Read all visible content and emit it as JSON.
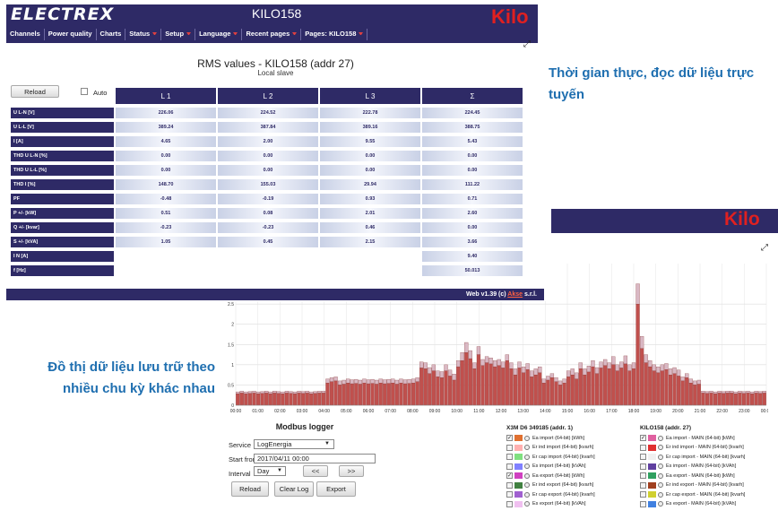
{
  "colors": {
    "brand": "#2e2a66",
    "kilo": "#e02020",
    "note": "#1f6fb0",
    "bar": "#c0504d",
    "bar_top": "#d9b8c4"
  },
  "app": {
    "logo": "ELECTREX",
    "model": "KILO158",
    "brand_badge": "Kilo"
  },
  "menu": [
    {
      "label": "Channels",
      "dropdown": false
    },
    {
      "label": "Power quality",
      "dropdown": false
    },
    {
      "label": "Charts",
      "dropdown": false
    },
    {
      "label": "Status",
      "dropdown": true
    },
    {
      "label": "Setup",
      "dropdown": true
    },
    {
      "label": "Language",
      "dropdown": true
    },
    {
      "label": "Recent pages",
      "dropdown": true
    },
    {
      "label": "Pages: KILO158",
      "dropdown": true
    }
  ],
  "rms": {
    "title": "RMS values - KILO158 (addr 27)",
    "subtitle": "Local slave",
    "reload": "Reload",
    "auto": "Auto",
    "headers": [
      "L 1",
      "L 2",
      "L 3",
      "Σ"
    ],
    "rows": [
      {
        "label": "U L-N [V]",
        "values": [
          "226.06",
          "224.52",
          "222.78",
          "224.45"
        ]
      },
      {
        "label": "U L-L [V]",
        "values": [
          "389.24",
          "387.84",
          "389.16",
          "388.75"
        ]
      },
      {
        "label": "I [A]",
        "values": [
          "4.65",
          "2.00",
          "9.55",
          "5.43"
        ]
      },
      {
        "label": "THD U L-N [%]",
        "values": [
          "0.00",
          "0.00",
          "0.00",
          "0.00"
        ]
      },
      {
        "label": "THD U L-L [%]",
        "values": [
          "0.00",
          "0.00",
          "0.00",
          "0.00"
        ]
      },
      {
        "label": "THD I [%]",
        "values": [
          "148.70",
          "155.03",
          "29.94",
          "111.22"
        ]
      },
      {
        "label": "PF",
        "values": [
          "-0.48",
          "-0.19",
          "0.93",
          "0.71"
        ]
      },
      {
        "label": "P +/- [kW]",
        "values": [
          "0.51",
          "0.08",
          "2.01",
          "2.60"
        ]
      },
      {
        "label": "Q +/- [kvar]",
        "values": [
          "-0.23",
          "-0.23",
          "0.46",
          "0.00"
        ]
      },
      {
        "label": "S +/- [kVA]",
        "values": [
          "1.05",
          "0.45",
          "2.15",
          "3.66"
        ]
      },
      {
        "label": "I N [A]",
        "values": [
          "",
          "",
          "",
          "9.40"
        ]
      },
      {
        "label": "f [Hz]",
        "values": [
          "",
          "",
          "",
          "50.013"
        ]
      }
    ],
    "footer_prefix": "Web v1.39 (c) ",
    "footer_link": "Akse",
    "footer_suffix": " s.r.l."
  },
  "notes": {
    "realtime": "Thời gian thực, đọc dữ liệu trực tuyến",
    "archive": "Đồ thị dữ liệu lưu trữ theo nhiều chu kỳ khác nhau"
  },
  "chart_data": {
    "type": "bar",
    "x_ticks": [
      "00:00",
      "01:00",
      "02:00",
      "03:00",
      "04:00",
      "05:00",
      "06:00",
      "07:00",
      "08:00",
      "09:00",
      "10:00",
      "11:00",
      "12:00",
      "13:00",
      "14:00",
      "15:00",
      "16:00",
      "17:00",
      "18:00",
      "19:00",
      "20:00",
      "21:00",
      "22:00",
      "23:00",
      "00:00"
    ],
    "y_ticks": [
      "0",
      "0.5",
      "1",
      "1.5",
      "2",
      "2.5"
    ],
    "ylim": [
      0,
      3.5
    ],
    "grid": true,
    "series": [
      {
        "values": [
          0.28,
          0.3,
          0.28,
          0.29,
          0.3,
          0.28,
          0.29,
          0.3,
          0.28,
          0.3,
          0.29,
          0.28,
          0.3,
          0.29,
          0.28,
          0.3,
          0.29,
          0.3,
          0.28,
          0.29,
          0.3,
          0.3,
          0.55,
          0.58,
          0.6,
          0.5,
          0.52,
          0.55,
          0.53,
          0.54,
          0.52,
          0.55,
          0.53,
          0.54,
          0.52,
          0.55,
          0.53,
          0.54,
          0.55,
          0.52,
          0.55,
          0.53,
          0.54,
          0.55,
          0.58,
          0.92,
          0.9,
          0.78,
          0.85,
          0.7,
          0.68,
          0.85,
          0.72,
          0.62,
          0.95,
          1.1,
          1.3,
          1.15,
          0.9,
          1.25,
          0.98,
          1.05,
          1.02,
          0.95,
          0.98,
          0.92,
          1.1,
          0.9,
          0.75,
          0.92,
          0.8,
          0.88,
          0.7,
          0.75,
          0.8,
          0.55,
          0.62,
          0.68,
          0.58,
          0.5,
          0.55,
          0.7,
          0.75,
          0.65,
          0.9,
          0.75,
          0.82,
          0.95,
          0.78,
          0.92,
          0.98,
          0.9,
          1.0,
          0.85,
          0.92,
          1.02,
          0.85,
          0.9,
          2.5,
          1.4,
          1.05,
          0.95,
          0.85,
          0.8,
          0.85,
          0.88,
          0.75,
          0.78,
          0.72,
          0.6,
          0.68,
          0.55,
          0.5,
          0.52,
          0.3,
          0.29,
          0.3,
          0.28,
          0.3,
          0.29,
          0.3,
          0.3,
          0.28,
          0.3,
          0.29,
          0.3,
          0.28,
          0.3,
          0.29,
          0.3
        ]
      },
      {
        "values": [
          0.05,
          0.05,
          0.05,
          0.05,
          0.05,
          0.05,
          0.05,
          0.05,
          0.05,
          0.05,
          0.05,
          0.05,
          0.05,
          0.05,
          0.05,
          0.05,
          0.05,
          0.05,
          0.05,
          0.05,
          0.05,
          0.05,
          0.1,
          0.1,
          0.1,
          0.1,
          0.1,
          0.1,
          0.1,
          0.1,
          0.1,
          0.1,
          0.1,
          0.1,
          0.1,
          0.1,
          0.1,
          0.1,
          0.1,
          0.1,
          0.1,
          0.1,
          0.1,
          0.1,
          0.1,
          0.15,
          0.15,
          0.15,
          0.15,
          0.15,
          0.15,
          0.15,
          0.15,
          0.15,
          0.15,
          0.2,
          0.25,
          0.2,
          0.15,
          0.2,
          0.15,
          0.15,
          0.15,
          0.15,
          0.15,
          0.15,
          0.15,
          0.15,
          0.15,
          0.15,
          0.15,
          0.15,
          0.15,
          0.15,
          0.15,
          0.1,
          0.1,
          0.1,
          0.1,
          0.1,
          0.1,
          0.15,
          0.15,
          0.15,
          0.15,
          0.15,
          0.15,
          0.15,
          0.15,
          0.15,
          0.15,
          0.15,
          0.2,
          0.15,
          0.15,
          0.2,
          0.15,
          0.15,
          0.5,
          0.3,
          0.2,
          0.15,
          0.15,
          0.15,
          0.15,
          0.15,
          0.15,
          0.15,
          0.15,
          0.1,
          0.1,
          0.1,
          0.1,
          0.1,
          0.05,
          0.05,
          0.05,
          0.05,
          0.05,
          0.05,
          0.05,
          0.05,
          0.05,
          0.05,
          0.05,
          0.05,
          0.05,
          0.05,
          0.05,
          0.05
        ]
      }
    ]
  },
  "logger": {
    "title": "Modbus logger",
    "service_label": "Service",
    "service_value": "LogEnergia",
    "start_label": "Start from",
    "start_value": "2017/04/11 00:00",
    "interval_label": "Interval",
    "interval_value": "Day",
    "prev": "<<",
    "next": ">>",
    "reload": "Reload",
    "clear": "Clear Log",
    "export": "Export"
  },
  "legend": {
    "groups": [
      {
        "title": "X3M D6 349185 (addr. 1)",
        "items": [
          {
            "label": "Ea import (64-bit) [kWh]",
            "color": "#e07030",
            "checked": true
          },
          {
            "label": "Er ind import (64-bit) [kvarh]",
            "color": "#ffb0b0",
            "checked": false
          },
          {
            "label": "Er cap import (64-bit) [kvarh]",
            "color": "#80e080",
            "checked": false
          },
          {
            "label": "Es import (64-bit) [kVAh]",
            "color": "#8080ff",
            "checked": false
          },
          {
            "label": "Ea export (64-bit) [kWh]",
            "color": "#d040c0",
            "checked": true
          },
          {
            "label": "Er ind export (64-bit) [kvarh]",
            "color": "#408040",
            "checked": false
          },
          {
            "label": "Er cap export (64-bit) [kvarh]",
            "color": "#a060d0",
            "checked": false
          },
          {
            "label": "Es export (64-bit) [kVAh]",
            "color": "#f0c0f0",
            "checked": false
          }
        ]
      },
      {
        "title": "KILO158 (addr. 27)",
        "items": [
          {
            "label": "Ea import - MAIN (64-bit) [kWh]",
            "color": "#e060a0",
            "checked": true
          },
          {
            "label": "Er ind import - MAIN (64-bit) [kvarh]",
            "color": "#e03030",
            "checked": false
          },
          {
            "label": "Er cap import - MAIN (64-bit) [kvarh]",
            "color": "#f0f0f0",
            "checked": false
          },
          {
            "label": "Es import - MAIN (64-bit) [kVAh]",
            "color": "#6040a0",
            "checked": false
          },
          {
            "label": "Ea export - MAIN (64-bit) [kWh]",
            "color": "#30a060",
            "checked": false
          },
          {
            "label": "Er ind export - MAIN (64-bit) [kvarh]",
            "color": "#a04020",
            "checked": false
          },
          {
            "label": "Er cap export - MAIN (64-bit) [kvarh]",
            "color": "#d0d030",
            "checked": false
          },
          {
            "label": "Es export - MAIN (64-bit) [kVAh]",
            "color": "#4080e0",
            "checked": false
          }
        ]
      }
    ]
  }
}
